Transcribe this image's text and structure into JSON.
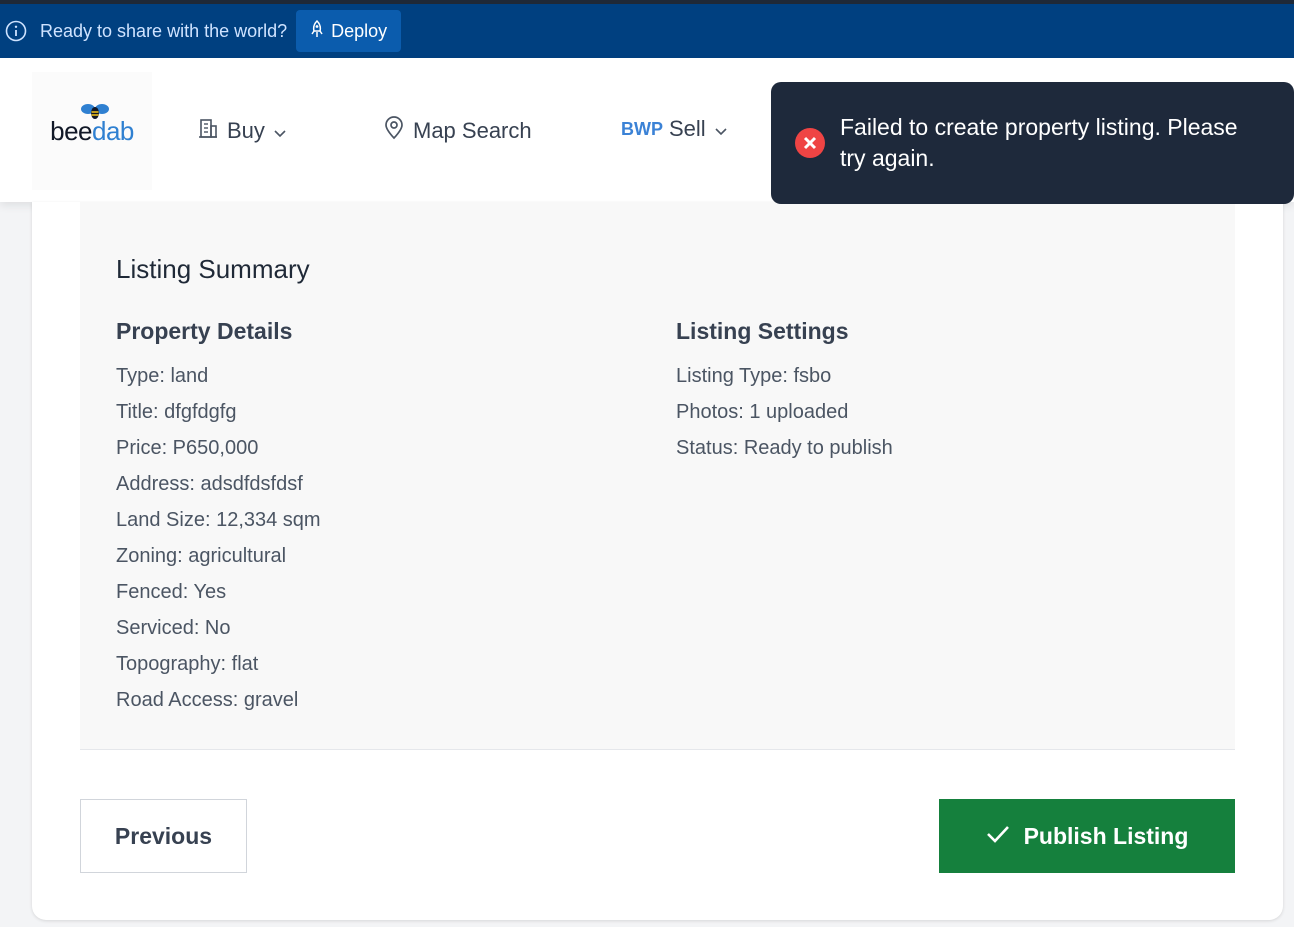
{
  "deploy_bar": {
    "message": "Ready to share with the world?",
    "button_label": "Deploy"
  },
  "logo": {
    "part1": "bee",
    "part2": "dab"
  },
  "nav": {
    "buy_label": "Buy",
    "map_search_label": "Map Search",
    "currency": "BWP",
    "sell_label": "Sell"
  },
  "toast": {
    "message": "Failed to create property listing. Please try again.",
    "type": "error"
  },
  "summary": {
    "title": "Listing Summary",
    "property_details": {
      "heading": "Property Details",
      "items": [
        "Type: land",
        "Title: dfgfdgfg",
        "Price: P650,000",
        "Address: adsdfdsfdsf",
        "Land Size: 12,334 sqm",
        "Zoning: agricultural",
        "Fenced: Yes",
        "Serviced: No",
        "Topography: flat",
        "Road Access: gravel"
      ]
    },
    "listing_settings": {
      "heading": "Listing Settings",
      "items": [
        "Listing Type: fsbo",
        "Photos: 1 uploaded",
        "Status: Ready to publish"
      ]
    }
  },
  "actions": {
    "previous_label": "Previous",
    "publish_label": "Publish Listing"
  },
  "colors": {
    "deploy_bar": "#004080",
    "toast_bg": "#1e293b",
    "error_icon": "#ef4444",
    "publish_button": "#15803d",
    "accent": "#3b82d6"
  },
  "icons": {
    "info": "info-icon",
    "deploy": "rocket-icon",
    "buy": "building-icon",
    "map": "map-pin-icon",
    "chevron": "chevron-down-icon",
    "error": "x-circle-icon",
    "check": "check-icon"
  }
}
